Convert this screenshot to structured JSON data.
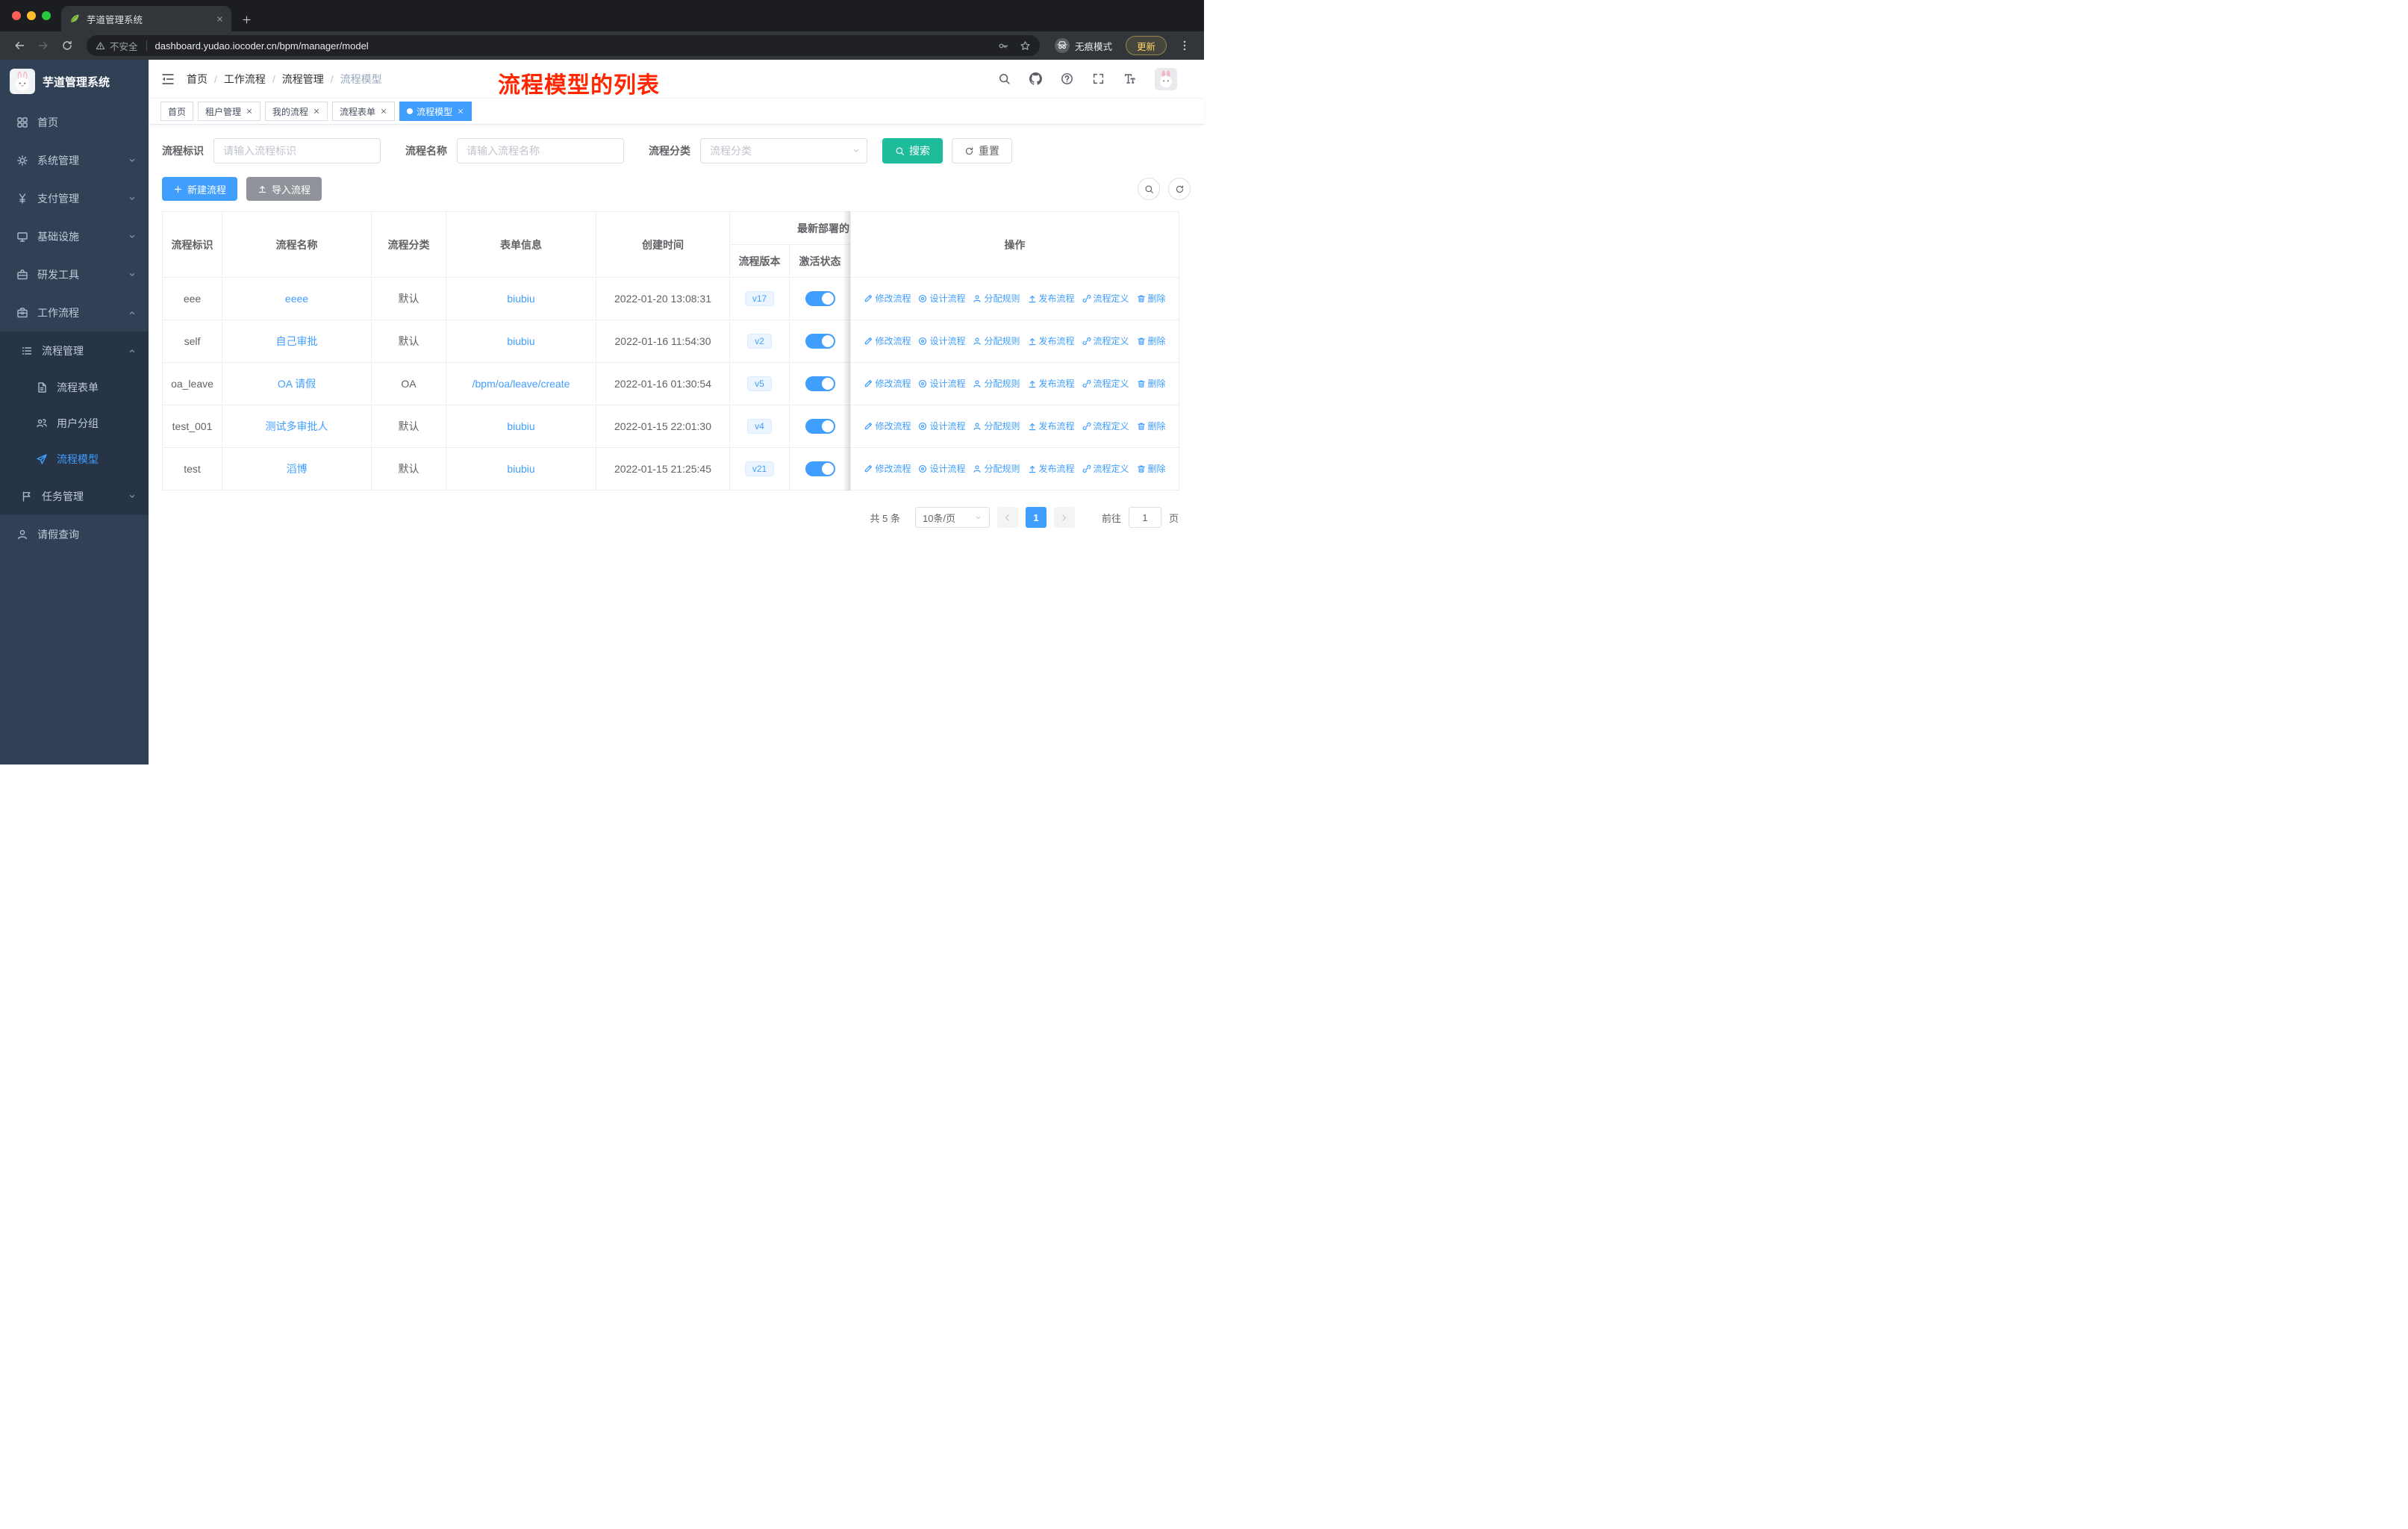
{
  "browser": {
    "tab": {
      "title": "芋道管理系统"
    },
    "address": {
      "security": "不安全",
      "url": "dashboard.yudao.iocoder.cn/bpm/manager/model"
    },
    "incognito": "无痕模式",
    "update": "更新"
  },
  "sidebar": {
    "title": "芋道管理系统",
    "items": [
      {
        "label": "首页",
        "icon": "dashboard-icon",
        "chevron": ""
      },
      {
        "label": "系统管理",
        "icon": "gear-icon",
        "chevron": "down"
      },
      {
        "label": "支付管理",
        "icon": "yen-icon",
        "chevron": "down"
      },
      {
        "label": "基础设施",
        "icon": "platform-icon",
        "chevron": "down"
      },
      {
        "label": "研发工具",
        "icon": "toolbox-icon",
        "chevron": "down"
      },
      {
        "label": "工作流程",
        "icon": "briefcase-icon",
        "chevron": "up"
      }
    ],
    "process_group": {
      "label": "流程管理",
      "icon": "list-icon",
      "chevron": "up",
      "children": [
        {
          "label": "流程表单",
          "icon": "document-icon",
          "active": false
        },
        {
          "label": "用户分组",
          "icon": "users-icon",
          "active": false
        },
        {
          "label": "流程模型",
          "icon": "paper-plane-icon",
          "active": true
        }
      ]
    },
    "task_group": {
      "label": "任务管理",
      "icon": "flag-icon",
      "chevron": "down"
    },
    "leave_item": {
      "label": "请假查询",
      "icon": "user-icon"
    }
  },
  "navbar": {
    "breadcrumb": [
      "首页",
      "工作流程",
      "流程管理",
      "流程模型"
    ],
    "annotation": "流程模型的列表"
  },
  "tags": [
    {
      "label": "首页",
      "closable": false,
      "active": false
    },
    {
      "label": "租户管理",
      "closable": true,
      "active": false
    },
    {
      "label": "我的流程",
      "closable": true,
      "active": false
    },
    {
      "label": "流程表单",
      "closable": true,
      "active": false
    },
    {
      "label": "流程模型",
      "closable": true,
      "active": true
    }
  ],
  "filters": {
    "key_label": "流程标识",
    "key_placeholder": "请输入流程标识",
    "name_label": "流程名称",
    "name_placeholder": "请输入流程名称",
    "category_label": "流程分类",
    "category_placeholder": "流程分类",
    "search": "搜索",
    "reset": "重置"
  },
  "toolbar": {
    "create": "新建流程",
    "import": "导入流程"
  },
  "table": {
    "headers": [
      "流程标识",
      "流程名称",
      "流程分类",
      "表单信息",
      "创建时间"
    ],
    "group_header": "最新部署的",
    "sub_headers": [
      "流程版本",
      "激活状态"
    ],
    "ops_header": "操作",
    "ops": [
      {
        "name": "edit",
        "label": "修改流程",
        "icon": "edit-icon"
      },
      {
        "name": "design",
        "label": "设计流程",
        "icon": "design-icon"
      },
      {
        "name": "assign",
        "label": "分配规则",
        "icon": "assign-icon"
      },
      {
        "name": "publish",
        "label": "发布流程",
        "icon": "publish-icon"
      },
      {
        "name": "definition",
        "label": "流程定义",
        "icon": "definition-icon"
      },
      {
        "name": "delete",
        "label": "删除",
        "icon": "delete-icon"
      }
    ],
    "rows": [
      {
        "key": "eee",
        "name": "eeee",
        "category": "默认",
        "form": "biubiu",
        "created": "2022-01-20 13:08:31",
        "version": "v17",
        "active": true
      },
      {
        "key": "self",
        "name": "自己审批",
        "category": "默认",
        "form": "biubiu",
        "created": "2022-01-16 11:54:30",
        "version": "v2",
        "active": true
      },
      {
        "key": "oa_leave",
        "name": "OA 请假",
        "category": "OA",
        "form": "/bpm/oa/leave/create",
        "created": "2022-01-16 01:30:54",
        "version": "v5",
        "active": true
      },
      {
        "key": "test_001",
        "name": "测试多审批人",
        "category": "默认",
        "form": "biubiu",
        "created": "2022-01-15 22:01:30",
        "version": "v4",
        "active": true
      },
      {
        "key": "test",
        "name": "滔博",
        "category": "默认",
        "form": "biubiu",
        "created": "2022-01-15 21:25:45",
        "version": "v21",
        "active": true
      }
    ]
  },
  "pagination": {
    "total": "共 5 条",
    "page_size": "10条/页",
    "current": "1",
    "goto_label": "前往",
    "goto_value": "1",
    "page_label": "页"
  },
  "colors": {
    "primary": "#409eff",
    "search_button": "#1fbc9c",
    "annotation": "#ff2600",
    "sidebar_bg": "#304156",
    "submenu_bg": "#263445"
  }
}
